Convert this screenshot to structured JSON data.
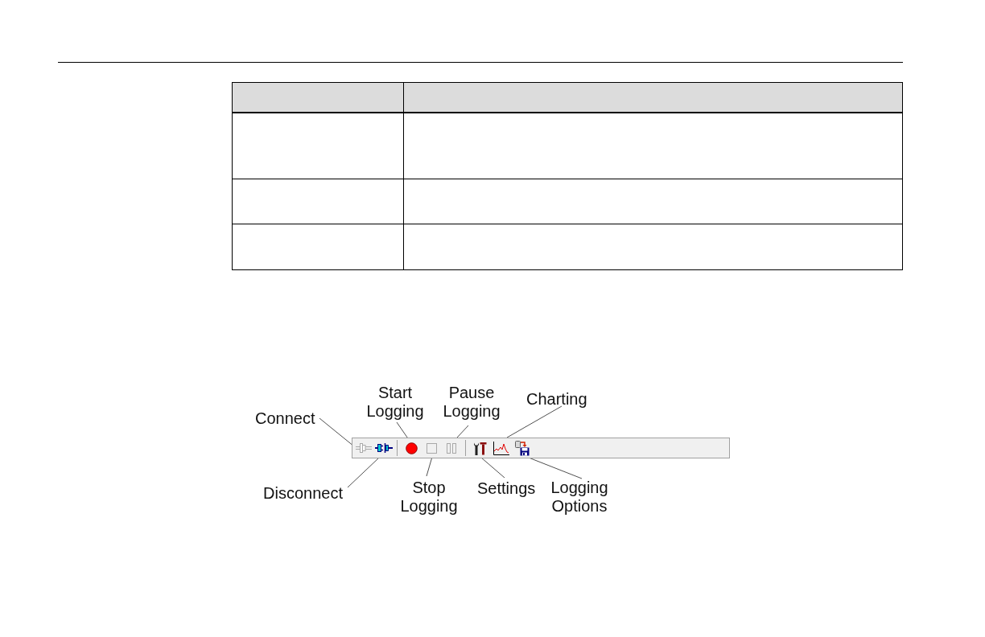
{
  "table": {
    "rows": [
      {
        "kind": "header"
      },
      {
        "kind": "body"
      },
      {
        "kind": "body"
      },
      {
        "kind": "body"
      }
    ]
  },
  "figure": {
    "toolbar": {
      "groups": [
        {
          "buttons": [
            {
              "kind": "connect",
              "label": "Connect",
              "disabled": true
            },
            {
              "kind": "disconnect",
              "label": "Disconnect",
              "disabled": false
            }
          ]
        },
        {
          "buttons": [
            {
              "kind": "start",
              "label": "Start Logging",
              "disabled": false
            },
            {
              "kind": "stop",
              "label": "Stop Logging",
              "disabled": true
            },
            {
              "kind": "pause",
              "label": "Pause Logging",
              "disabled": true
            }
          ]
        },
        {
          "buttons": [
            {
              "kind": "settings",
              "label": "Settings",
              "disabled": false
            },
            {
              "kind": "charting",
              "label": "Charting",
              "disabled": false
            },
            {
              "kind": "logging_options",
              "label": "Logging Options",
              "disabled": false
            }
          ]
        }
      ]
    }
  }
}
